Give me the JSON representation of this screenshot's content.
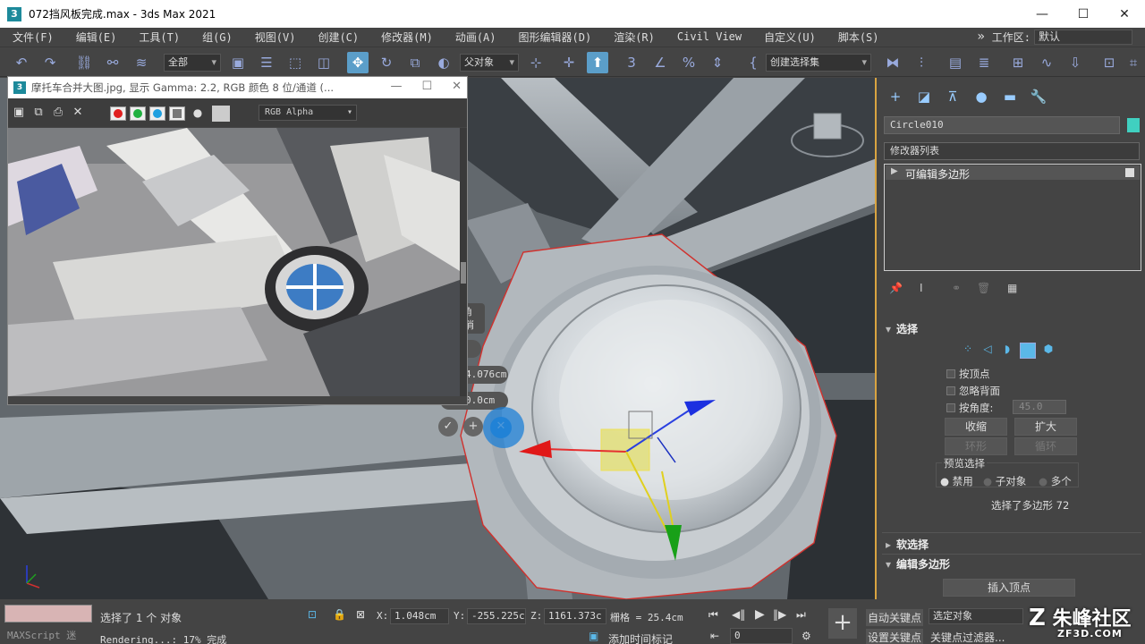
{
  "window": {
    "title": "072挡风板完成.max - 3ds Max 2021",
    "app_icon": "3"
  },
  "menu": {
    "items": [
      "文件(F)",
      "编辑(E)",
      "工具(T)",
      "组(G)",
      "视图(V)",
      "创建(C)",
      "修改器(M)",
      "动画(A)",
      "图形编辑器(D)",
      "渲染(R)",
      "Civil View",
      "自定义(U)",
      "脚本(S)"
    ],
    "workspace_label": "工作区:",
    "workspace_value": "默认",
    "overflow": "»"
  },
  "toolbar": {
    "filter_value": "全部",
    "coord_value": "父对象",
    "selection_set": "创建选择集"
  },
  "frame_window": {
    "title": "摩托车合并大图.jpg, 显示 Gamma: 2.2, RGB 颜色 8 位/通道 (...",
    "channel": "RGB Alpha",
    "colors": {
      "red": "#e02020",
      "green": "#20b040",
      "blue": "#20a0e0"
    }
  },
  "caddy": {
    "label1": "倒角",
    "label2": "-取消",
    "height": "4.076cm",
    "outline": "0.0cm"
  },
  "command_panel": {
    "object_name": "Circle010",
    "object_color": "#40d0c0",
    "modifier_list": "修改器列表",
    "stack_item": "可编辑多边形",
    "selection_rollout": "选择",
    "by_vertex": "按顶点",
    "ignore_backfacing": "忽略背面",
    "by_angle": "按角度:",
    "angle_value": "45.0",
    "shrink": "收缩",
    "grow": "扩大",
    "ring": "环形",
    "loop": "循环",
    "preview_label": "预览选择",
    "preview_off": "禁用",
    "preview_sub": "子对象",
    "preview_multi": "多个",
    "selected_info": "选择了多边形 72",
    "soft_selection": "软选择",
    "edit_poly": "编辑多边形",
    "insert_vertex": "插入顶点"
  },
  "statusbar": {
    "selection_text": "选择了 1 个 对象",
    "render_text": "Rendering...: 17% 完成",
    "maxscript": "MAXScript 迷",
    "x_label": "X:",
    "x_value": "1.048cm",
    "y_label": "Y:",
    "y_value": "-255.225c",
    "z_label": "Z:",
    "z_value": "1161.373c",
    "grid": "栅格 = 25.4cm",
    "add_time_tag": "添加时间标记",
    "frame_value": "0",
    "auto_key": "自动关键点",
    "selected_object": "选定对象",
    "set_key": "设置关键点",
    "key_filters": "关键点过滤器..."
  },
  "watermark": {
    "brand": "朱峰社区",
    "url": "ZF3D.COM"
  }
}
